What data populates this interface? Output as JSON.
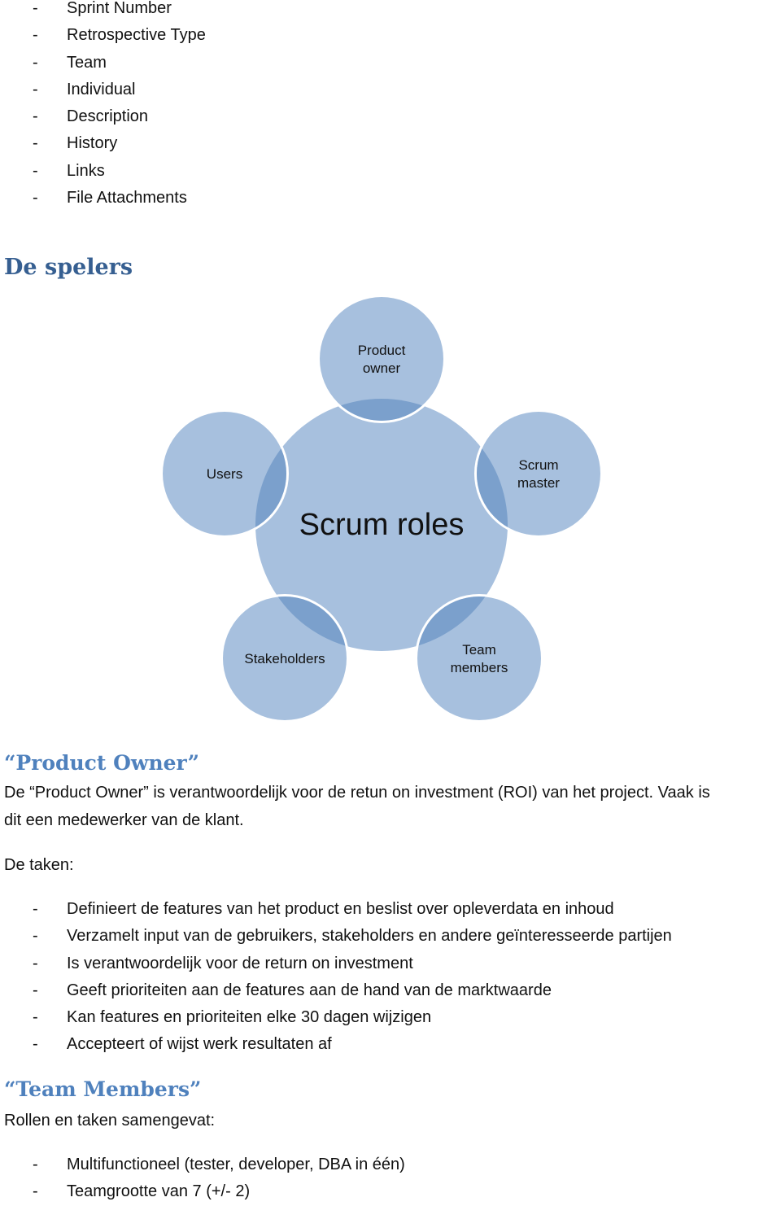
{
  "top_list": {
    "items": [
      "Sprint Number",
      "Retrospective Type",
      "Team",
      "Individual",
      "Description",
      "History",
      "Links",
      "File Attachments"
    ],
    "bullet": "-"
  },
  "section_spelers": {
    "heading": "De spelers"
  },
  "diagram": {
    "center_label": "Scrum roles",
    "roles": [
      {
        "id": "product-owner",
        "lines": [
          "Product",
          "owner"
        ]
      },
      {
        "id": "scrum-master",
        "lines": [
          "Scrum",
          "master"
        ]
      },
      {
        "id": "team-members",
        "lines": [
          "Team",
          "members"
        ]
      },
      {
        "id": "stakeholders",
        "lines": [
          "Stakeholders"
        ]
      },
      {
        "id": "users",
        "lines": [
          "Users"
        ]
      }
    ],
    "colors": {
      "fill": "#a7c0de",
      "overlap": "#7ba0cc",
      "outline": "#ffffff"
    }
  },
  "product_owner": {
    "heading": "“Product Owner”",
    "intro_line1": "De “Product Owner” is verantwoordelijk voor de retun on investment (ROI) van het project. Vaak is",
    "intro_line2": "dit een medewerker van de klant.",
    "tasks_label": "De taken:",
    "tasks": [
      "Definieert de features van het product en beslist over opleverdata en inhoud",
      "Verzamelt input van de gebruikers, stakeholders en andere geïnteresseerde partijen",
      "Is verantwoordelijk voor de return on investment",
      "Geeft prioriteiten aan de features aan de hand van de marktwaarde",
      "Kan features en prioriteiten elke 30 dagen wijzigen",
      "Accepteert of wijst werk resultaten af"
    ]
  },
  "team_members": {
    "heading": "“Team Members”",
    "summary_label": "Rollen en taken samengevat:",
    "items": [
      "Multifunctioneel (tester, developer, DBA in één)",
      "Teamgrootte van 7 (+/- 2)"
    ]
  }
}
